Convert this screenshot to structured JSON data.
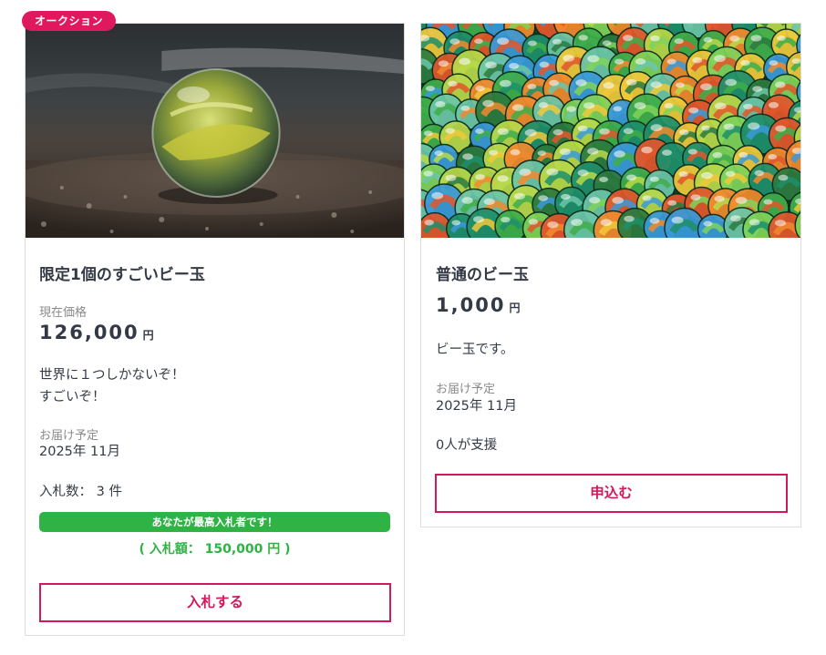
{
  "cards": [
    {
      "badge": "オークション",
      "image_alt": "marble-on-ground-photo",
      "title": "限定1個のすごいビー玉",
      "price_label": "現在価格",
      "price": "126,000",
      "currency": "円",
      "description_lines": [
        "世界に１つしかないぞ！",
        "すごいぞ！"
      ],
      "delivery_label": "お届け予定",
      "delivery_value": "2025年 11月",
      "bid_count": "入札数： 3 件",
      "winner_notice": "あなたが最高入札者です！",
      "my_bid": "( 入札額： 150,000 円 )",
      "button_label": "入札する"
    },
    {
      "image_alt": "pile-of-marbles-photo",
      "title": "普通のビー玉",
      "price": "1,000",
      "currency": "円",
      "description": "ビー玉です。",
      "delivery_label": "お届け予定",
      "delivery_value": "2025年 11月",
      "supporters": "0人が支援",
      "button_label": "申込む"
    }
  ],
  "colors": {
    "accent": "#d3195d",
    "badge": "#e0195f",
    "success": "#2fb344"
  }
}
